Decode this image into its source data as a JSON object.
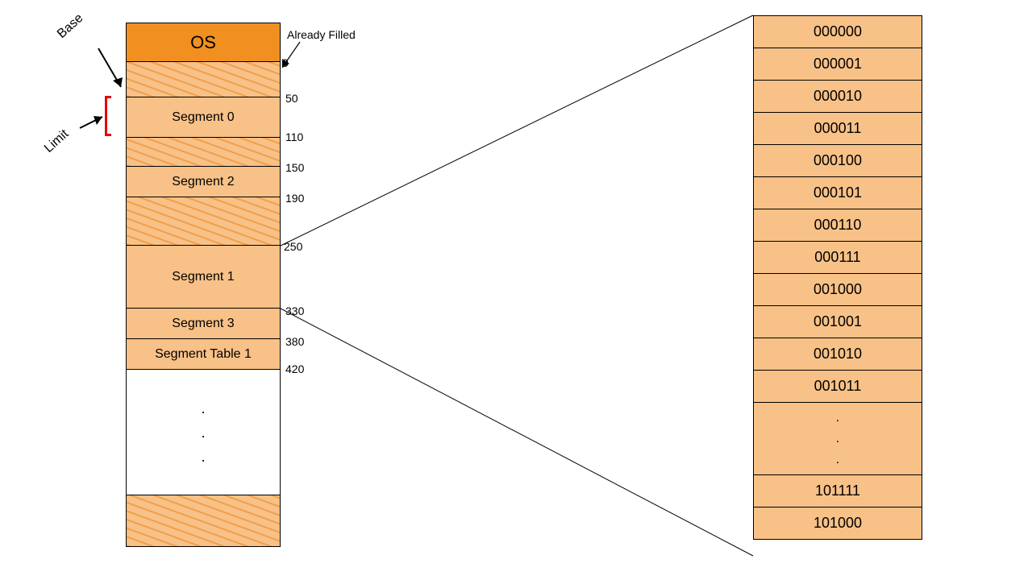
{
  "memory": {
    "os_label": "OS",
    "already_filled_label": "Already Filled",
    "segments": {
      "seg0": "Segment 0",
      "seg2": "Segment 2",
      "seg1": "Segment 1",
      "seg3": "Segment 3",
      "segtable1": "Segment Table 1"
    },
    "addresses": {
      "a0": "0",
      "a50": "50",
      "a110": "110",
      "a150": "150",
      "a190": "190",
      "a250": "250",
      "a330": "330",
      "a380": "380",
      "a420": "420"
    }
  },
  "annotations": {
    "base": "Base",
    "limit": "Limit"
  },
  "binary": {
    "rows": {
      "r0": "000000",
      "r1": "000001",
      "r2": "000010",
      "r3": "000011",
      "r4": "000100",
      "r5": "000101",
      "r6": "000110",
      "r7": "000111",
      "r8": "001000",
      "r9": "001001",
      "r10": "001010",
      "r11": "001011",
      "r12": "101111",
      "r13": "101000"
    }
  },
  "dots": {
    "d1": ".",
    "d2": ".",
    "d3": "."
  }
}
